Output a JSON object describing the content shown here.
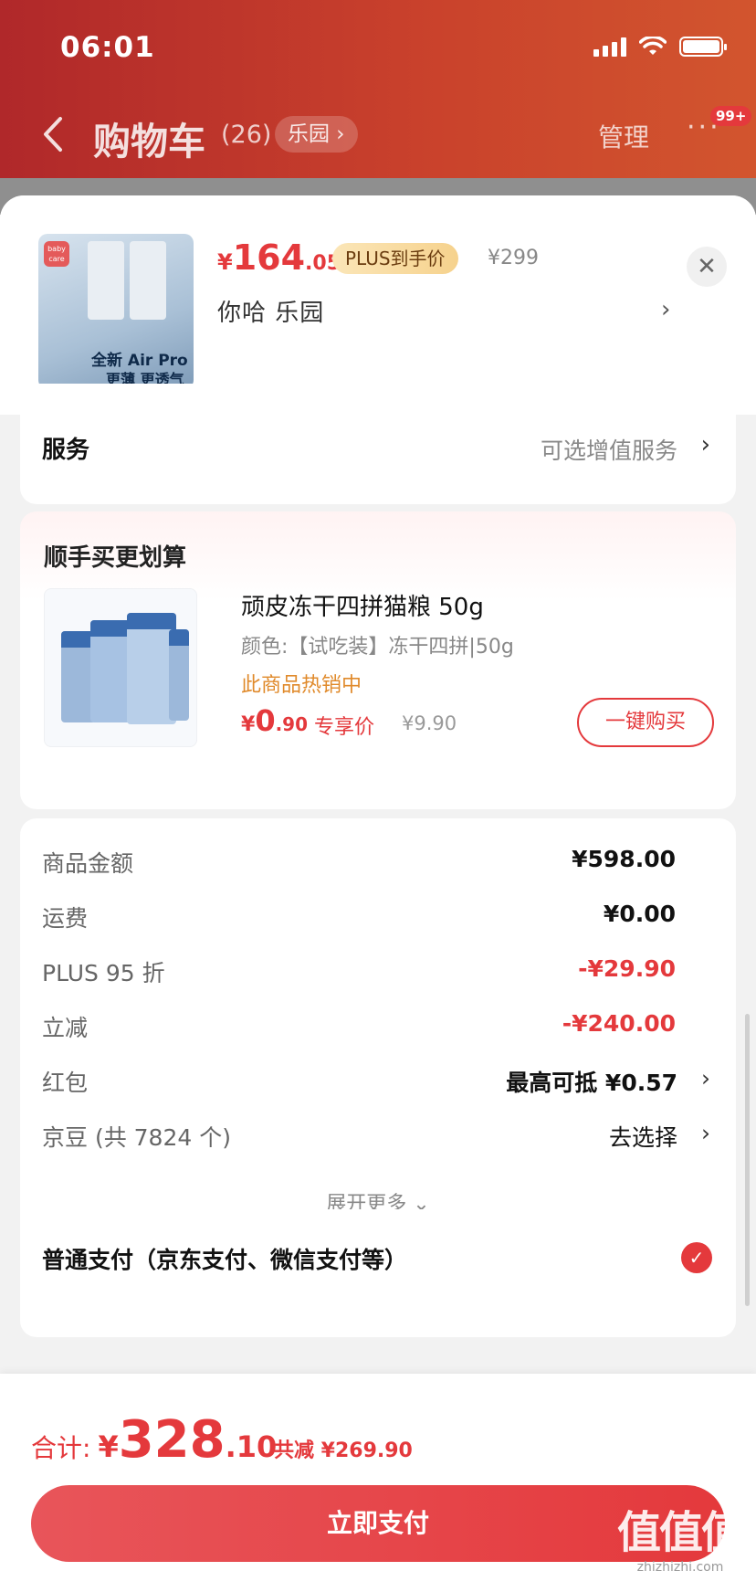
{
  "status": {
    "time": "06:01"
  },
  "nav": {
    "title": "购物车",
    "count": "(26)",
    "chip": "乐园 ›",
    "manage": "管理",
    "more": "···",
    "badge": "99+"
  },
  "product": {
    "image_line1": "全新 Air Pro",
    "image_line2": "更薄 更透气",
    "price_symbol": "¥",
    "price_int": "164",
    "price_dec": ".05",
    "plus_tag": "PLUS到手价",
    "orig_price": "¥299",
    "spec": "你哈  乐园",
    "close": "✕",
    "arrow": "›"
  },
  "service": {
    "label": "服务",
    "value": "可选增值服务",
    "arrow": "›"
  },
  "upsell": {
    "title": "顺手买更划算",
    "name": "顽皮冻干四拼猫粮 50g",
    "spec": "颜色:【试吃装】冻干四拼|50g",
    "hot": "此商品热销中",
    "price_symbol": "¥",
    "price_int": "0",
    "price_dec": ".90",
    "exclusive": "专享价",
    "orig_price": "¥9.90",
    "buy_button": "一键购买"
  },
  "summary": {
    "rows": [
      {
        "label": "商品金额",
        "value": "¥598.00"
      },
      {
        "label": "运费",
        "value": "¥0.00"
      },
      {
        "label": "PLUS 95 折",
        "value": "-¥29.90"
      },
      {
        "label": "立减",
        "value": "-¥240.00"
      },
      {
        "label": "红包",
        "value": "最高可抵 ¥0.57"
      },
      {
        "label": "京豆 (共 7824 个)",
        "value": "去选择"
      }
    ],
    "expand": "展开更多 ⌄",
    "arrow": "›"
  },
  "payment": {
    "label": "普通支付（京东支付、微信支付等）",
    "check": "✓"
  },
  "bottom": {
    "total_label": "合计:",
    "total_symbol": "¥",
    "total_int": "328",
    "total_dec": ".10",
    "saved": "共减 ¥269.90",
    "pay_button": "立即支付"
  },
  "watermark": {
    "big": "值值值",
    "small": "zhizhizhi.com"
  },
  "colors": {
    "accent": "#e4393c",
    "header": "#c9412c"
  }
}
